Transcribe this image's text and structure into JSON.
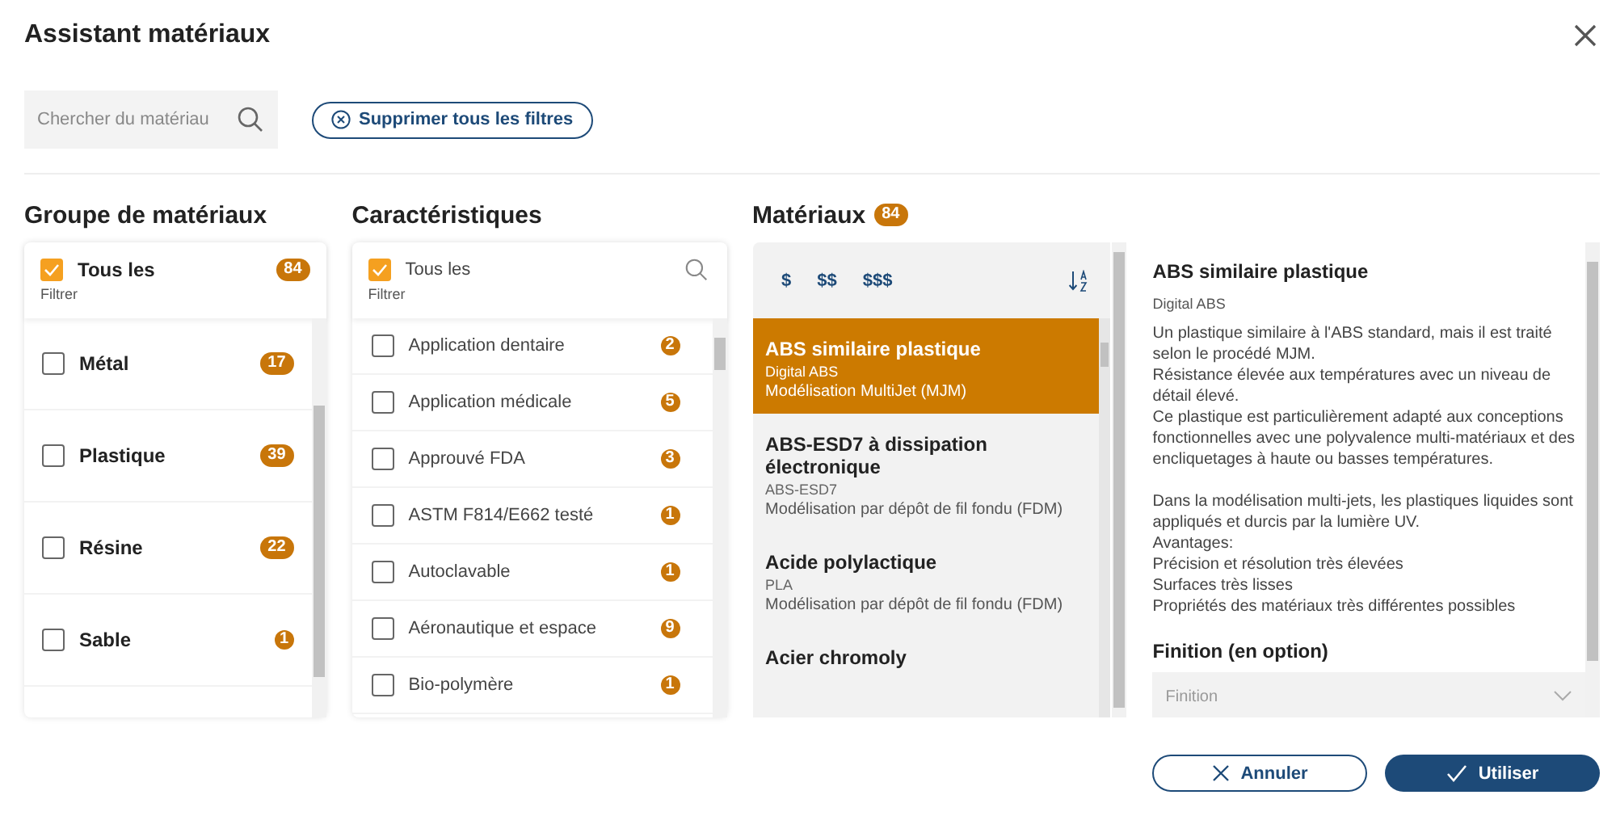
{
  "dialog": {
    "title": "Assistant matériaux"
  },
  "search": {
    "placeholder": "Chercher du matériau"
  },
  "clear_filters_button": "Supprimer tous les filtres",
  "material_groups": {
    "heading": "Groupe de matériaux",
    "all": {
      "label": "Tous les",
      "count": "84",
      "checked": true,
      "sublabel": "Filtrer"
    },
    "items": [
      {
        "label": "Métal",
        "count": "17",
        "checked": false
      },
      {
        "label": "Plastique",
        "count": "39",
        "checked": false
      },
      {
        "label": "Résine",
        "count": "22",
        "checked": false
      },
      {
        "label": "Sable",
        "count": "1",
        "checked": false
      }
    ]
  },
  "characteristics": {
    "heading": "Caractéristiques",
    "all": {
      "label": "Tous les",
      "checked": true,
      "sublabel": "Filtrer"
    },
    "items": [
      {
        "label": "Application dentaire",
        "count": "2",
        "checked": false
      },
      {
        "label": "Application médicale",
        "count": "5",
        "checked": false
      },
      {
        "label": "Approuvé FDA",
        "count": "3",
        "checked": false
      },
      {
        "label": "ASTM F814/E662 testé",
        "count": "1",
        "checked": false
      },
      {
        "label": "Autoclavable",
        "count": "1",
        "checked": false
      },
      {
        "label": "Aéronautique et espace",
        "count": "9",
        "checked": false
      },
      {
        "label": "Bio-polymère",
        "count": "1",
        "checked": false
      }
    ]
  },
  "materials": {
    "heading": "Matériaux",
    "count": "84",
    "price_filters": [
      "$",
      "$$",
      "$$$"
    ],
    "items": [
      {
        "name": "ABS similaire plastique",
        "code": "Digital ABS",
        "process": "Modélisation MultiJet (MJM)",
        "selected": true
      },
      {
        "name": "ABS-ESD7 à dissipation électronique",
        "code": "ABS-ESD7",
        "process": "Modélisation par dépôt de fil fondu (FDM)",
        "selected": false
      },
      {
        "name": "Acide polylactique",
        "code": "PLA",
        "process": "Modélisation par dépôt de fil fondu (FDM)",
        "selected": false
      },
      {
        "name": "Acier chromoly",
        "selected": false
      }
    ]
  },
  "details": {
    "title": "ABS similaire plastique",
    "subtitle": "Digital ABS",
    "paragraphs": [
      [
        "Un plastique similaire à l'ABS standard, mais il est traité selon le procédé MJM.",
        "Résistance élevée aux températures avec un niveau de détail élevé.",
        "Ce plastique est particulièrement adapté aux conceptions fonctionnelles avec une polyvalence multi-matériaux et des encliquetages à haute ou basses températures."
      ],
      [
        "Dans la modélisation multi-jets, les plastiques liquides sont appliqués et durcis par la lumière UV.",
        "Avantages:",
        "Précision et résolution très élevées",
        "Surfaces très lisses",
        "Propriétés des matériaux très différentes possibles"
      ]
    ],
    "finish_heading": "Finition (en option)",
    "finish_placeholder": "Finition"
  },
  "buttons": {
    "cancel": "Annuler",
    "confirm": "Utiliser"
  }
}
